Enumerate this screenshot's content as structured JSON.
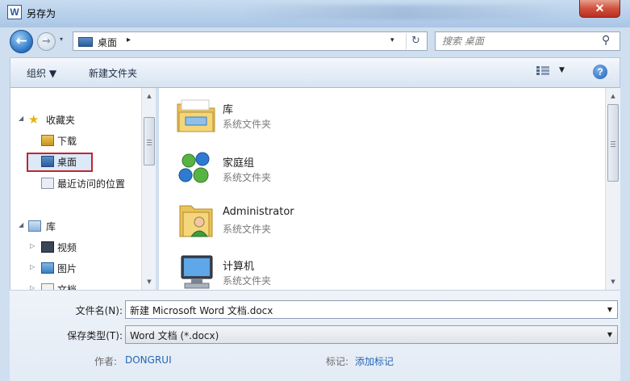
{
  "window": {
    "title": "另存为",
    "app_icon": "W",
    "close": "✕"
  },
  "nav": {
    "back": "←",
    "forward": "→",
    "history": "▾",
    "location": "桌面",
    "crumb_arrow": "▸",
    "dropdown": "▾",
    "refresh": "↻",
    "search_placeholder": "搜索 桌面",
    "search_icon": "⚲"
  },
  "toolbar": {
    "organize": "组织 ▼",
    "new_folder": "新建文件夹",
    "view_dropdown": "▼",
    "help": "?"
  },
  "sidebar": {
    "items": [
      {
        "label": "收藏夹",
        "expander": "◢",
        "icon": "star-icon"
      },
      {
        "label": "下载",
        "expander": "",
        "icon": "downloads-icon"
      },
      {
        "label": "桌面",
        "expander": "",
        "icon": "desktop-icon"
      },
      {
        "label": "最近访问的位置",
        "expander": "",
        "icon": "recent-places-icon"
      },
      {
        "label": "库",
        "expander": "◢",
        "icon": "library-icon"
      },
      {
        "label": "视频",
        "expander": "▷",
        "icon": "video-icon"
      },
      {
        "label": "图片",
        "expander": "▷",
        "icon": "pictures-icon"
      },
      {
        "label": "文档",
        "expander": "▷",
        "icon": "documents-icon"
      }
    ]
  },
  "scroll": {
    "up": "▲",
    "down": "▼"
  },
  "files": [
    {
      "name": "库",
      "type": "系统文件夹",
      "icon": "library-folder-icon"
    },
    {
      "name": "家庭组",
      "type": "系统文件夹",
      "icon": "homegroup-icon"
    },
    {
      "name": "Administrator",
      "type": "系统文件夹",
      "icon": "user-folder-icon"
    },
    {
      "name": "计算机",
      "type": "系统文件夹",
      "icon": "computer-icon"
    }
  ],
  "form": {
    "filename_label": "文件名(N):",
    "filename_value": "新建 Microsoft Word 文档.docx",
    "savetype_label": "保存类型(T):",
    "savetype_value": "Word 文档 (*.docx)",
    "author_label": "作者:",
    "author_value": "DONGRUI",
    "tags_label": "标记:",
    "tags_value": "添加标记",
    "dropdown": "▼"
  }
}
